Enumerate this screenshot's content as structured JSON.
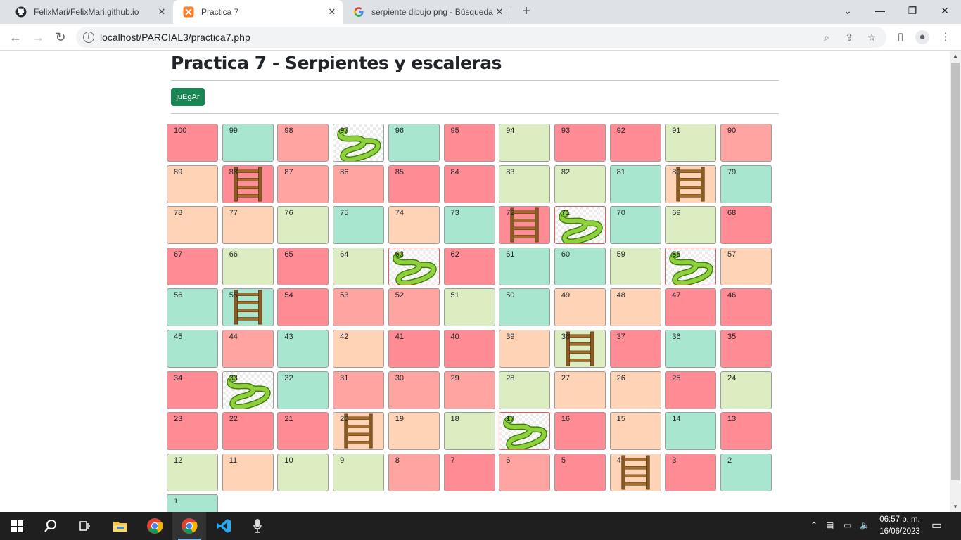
{
  "browser": {
    "tabs": [
      {
        "title": "FelixMari/FelixMari.github.io",
        "icon": "github-icon"
      },
      {
        "title": "Practica 7",
        "icon": "xampp-icon"
      },
      {
        "title": "serpiente dibujo png - Búsqueda",
        "icon": "google-icon"
      }
    ],
    "url": "localhost/PARCIAL3/practica7.php"
  },
  "page": {
    "title": "Practica 7 - Serpientes y escaleras",
    "play_button": "juEgAr"
  },
  "board": {
    "rows": [
      [
        {
          "n": "100",
          "c": 0
        },
        {
          "n": "99",
          "c": 1
        },
        {
          "n": "98",
          "c": 2
        },
        {
          "n": "97",
          "c": 5,
          "item": "snake"
        },
        {
          "n": "96",
          "c": 1
        },
        {
          "n": "95",
          "c": 0
        },
        {
          "n": "94",
          "c": 3
        },
        {
          "n": "93",
          "c": 0
        },
        {
          "n": "92",
          "c": 0
        },
        {
          "n": "91",
          "c": 3
        },
        {
          "n": "90",
          "c": 2
        }
      ],
      [
        {
          "n": "89",
          "c": 4
        },
        {
          "n": "88",
          "c": 0,
          "item": "ladder"
        },
        {
          "n": "87",
          "c": 2
        },
        {
          "n": "86",
          "c": 2
        },
        {
          "n": "85",
          "c": 0
        },
        {
          "n": "84",
          "c": 0
        },
        {
          "n": "83",
          "c": 3
        },
        {
          "n": "82",
          "c": 3
        },
        {
          "n": "81",
          "c": 1
        },
        {
          "n": "80",
          "c": 4,
          "item": "ladder"
        },
        {
          "n": "79",
          "c": 1
        }
      ],
      [
        {
          "n": "78",
          "c": 4
        },
        {
          "n": "77",
          "c": 4
        },
        {
          "n": "76",
          "c": 3
        },
        {
          "n": "75",
          "c": 1
        },
        {
          "n": "74",
          "c": 4
        },
        {
          "n": "73",
          "c": 1
        },
        {
          "n": "72",
          "c": 0,
          "item": "ladder"
        },
        {
          "n": "71",
          "c": 5,
          "item": "snake",
          "border": "r"
        },
        {
          "n": "70",
          "c": 1
        },
        {
          "n": "69",
          "c": 3
        },
        {
          "n": "68",
          "c": 0
        }
      ],
      [
        {
          "n": "67",
          "c": 0
        },
        {
          "n": "66",
          "c": 3
        },
        {
          "n": "65",
          "c": 0
        },
        {
          "n": "64",
          "c": 3
        },
        {
          "n": "63",
          "c": 5,
          "item": "snake",
          "border": "r"
        },
        {
          "n": "62",
          "c": 0
        },
        {
          "n": "61",
          "c": 1
        },
        {
          "n": "60",
          "c": 1
        },
        {
          "n": "59",
          "c": 3
        },
        {
          "n": "58",
          "c": 5,
          "item": "snake",
          "border": "r"
        },
        {
          "n": "57",
          "c": 4
        }
      ],
      [
        {
          "n": "56",
          "c": 1
        },
        {
          "n": "55",
          "c": 1,
          "item": "ladder"
        },
        {
          "n": "54",
          "c": 0
        },
        {
          "n": "53",
          "c": 2
        },
        {
          "n": "52",
          "c": 2
        },
        {
          "n": "51",
          "c": 3
        },
        {
          "n": "50",
          "c": 1
        },
        {
          "n": "49",
          "c": 4
        },
        {
          "n": "48",
          "c": 4
        },
        {
          "n": "47",
          "c": 0
        },
        {
          "n": "46",
          "c": 0
        }
      ],
      [
        {
          "n": "45",
          "c": 1
        },
        {
          "n": "44",
          "c": 2
        },
        {
          "n": "43",
          "c": 1
        },
        {
          "n": "42",
          "c": 4
        },
        {
          "n": "41",
          "c": 0
        },
        {
          "n": "40",
          "c": 0
        },
        {
          "n": "39",
          "c": 4
        },
        {
          "n": "38",
          "c": 3,
          "item": "ladder"
        },
        {
          "n": "37",
          "c": 0
        },
        {
          "n": "36",
          "c": 1
        },
        {
          "n": "35",
          "c": 0
        }
      ],
      [
        {
          "n": "34",
          "c": 0
        },
        {
          "n": "33",
          "c": 5,
          "item": "snake"
        },
        {
          "n": "32",
          "c": 1
        },
        {
          "n": "31",
          "c": 2
        },
        {
          "n": "30",
          "c": 2
        },
        {
          "n": "29",
          "c": 2
        },
        {
          "n": "28",
          "c": 3
        },
        {
          "n": "27",
          "c": 4
        },
        {
          "n": "26",
          "c": 4
        },
        {
          "n": "25",
          "c": 0
        },
        {
          "n": "24",
          "c": 3
        }
      ],
      [
        {
          "n": "23",
          "c": 0
        },
        {
          "n": "22",
          "c": 0
        },
        {
          "n": "21",
          "c": 0
        },
        {
          "n": "20",
          "c": 4,
          "item": "ladder"
        },
        {
          "n": "19",
          "c": 4
        },
        {
          "n": "18",
          "c": 3
        },
        {
          "n": "17",
          "c": 5,
          "item": "snake",
          "border": "r"
        },
        {
          "n": "16",
          "c": 0
        },
        {
          "n": "15",
          "c": 4
        },
        {
          "n": "14",
          "c": 1
        },
        {
          "n": "13",
          "c": 0
        }
      ],
      [
        {
          "n": "12",
          "c": 3
        },
        {
          "n": "11",
          "c": 4
        },
        {
          "n": "10",
          "c": 3
        },
        {
          "n": "9",
          "c": 3
        },
        {
          "n": "8",
          "c": 2
        },
        {
          "n": "7",
          "c": 0
        },
        {
          "n": "6",
          "c": 2
        },
        {
          "n": "5",
          "c": 0
        },
        {
          "n": "4",
          "c": 4,
          "item": "ladder"
        },
        {
          "n": "3",
          "c": 0
        },
        {
          "n": "2",
          "c": 1
        }
      ],
      [
        {
          "n": "1",
          "c": 1
        }
      ]
    ]
  },
  "taskbar": {
    "time": "06:57 p. m.",
    "date": "16/06/2023"
  }
}
